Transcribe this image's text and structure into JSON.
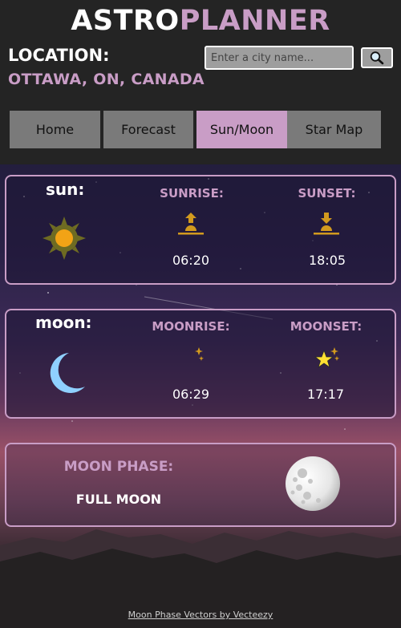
{
  "app": {
    "title_part1": "ASTRO",
    "title_part2": "PLANNER"
  },
  "location": {
    "label": "LOCATION:",
    "value": "OTTAWA, ON, CANADA"
  },
  "search": {
    "placeholder": "Enter a city name...",
    "value": ""
  },
  "tabs": [
    {
      "label": "Home",
      "active": false
    },
    {
      "label": "Forecast",
      "active": false
    },
    {
      "label": "Sun/Moon",
      "active": true
    },
    {
      "label": "Star Map",
      "active": false
    }
  ],
  "sun": {
    "title": "sun:",
    "sunrise_label": "SUNRISE:",
    "sunrise_time": "06:20",
    "sunset_label": "SUNSET:",
    "sunset_time": "18:05"
  },
  "moon": {
    "title": "moon:",
    "moonrise_label": "MOONRISE:",
    "moonrise_time": "06:29",
    "moonset_label": "MOONSET:",
    "moonset_time": "17:17"
  },
  "moon_phase": {
    "label": "MOON PHASE:",
    "value": "FULL MOON"
  },
  "footer": {
    "credit": "Moon Phase Vectors by Vecteezy"
  },
  "colors": {
    "accent": "#c99dc6",
    "tab_bg": "#7a7a7a",
    "sun_gold": "#d29a1e",
    "moon_blue": "#8fd0ff",
    "star_yellow": "#ffe033"
  }
}
